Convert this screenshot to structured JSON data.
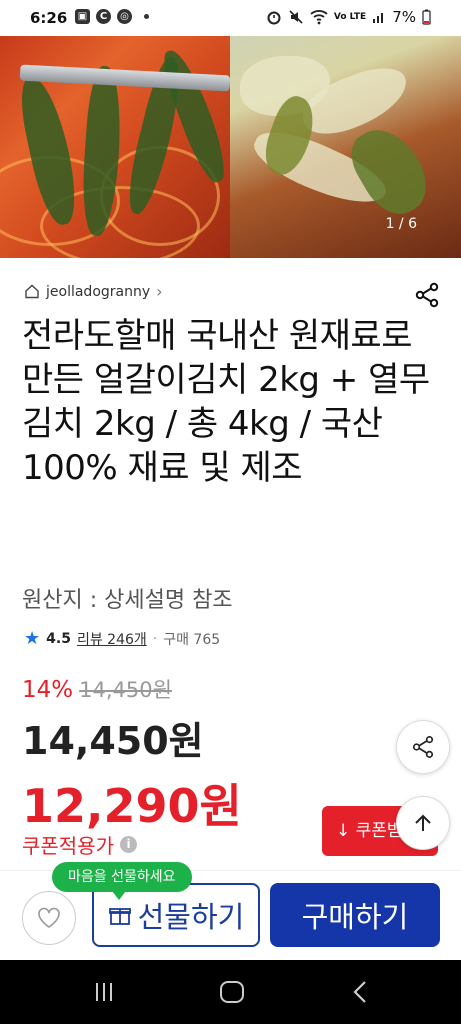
{
  "status_bar": {
    "time": "6:26",
    "left_icons": [
      "image-icon",
      "c-icon",
      "target-icon"
    ],
    "right_icons": [
      "alarm-icon",
      "mute-icon",
      "wifi-icon",
      "volte-icon",
      "signal-icon",
      "battery-icon"
    ],
    "battery": "7%"
  },
  "hero": {
    "counter": "1 / 6"
  },
  "seller": {
    "name": "jeolladogranny",
    "chevron": "›"
  },
  "product": {
    "title": "전라도할매 국내산 원재료로 만든 얼갈이김치  2kg + 열무김치 2kg / 총 4kg / 국산 100% 재료 및 제조",
    "origin": "원산지 : 상세설명 참조"
  },
  "rating": {
    "score": "4.5",
    "reviews": "리뷰 246개",
    "separator": "·",
    "purchases": "구매 765"
  },
  "pricing": {
    "discount": "14%",
    "original": "14,450원",
    "price": "14,450원",
    "coupon_price": "12,290원",
    "coupon_applied": "쿠폰적용가",
    "coupon_badge": "↓ 쿠폰받",
    "accent_color": "#e4202a"
  },
  "bottom_bar": {
    "gift_tooltip": "마음을 선물하세요",
    "gift_label": "선물하기",
    "buy_label": "구매하기",
    "brand_color": "#1536a8"
  }
}
